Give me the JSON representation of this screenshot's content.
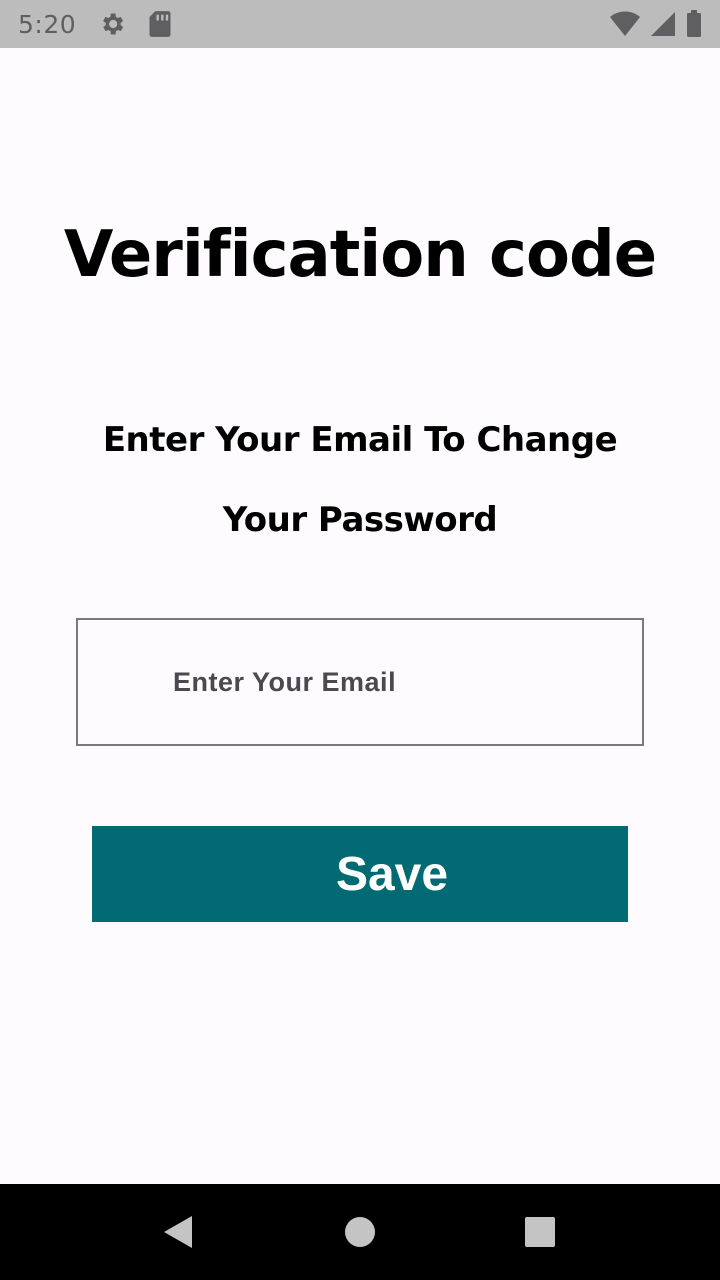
{
  "status_bar": {
    "time": "5:20",
    "icons_left": [
      "settings-icon",
      "sd-card-icon"
    ],
    "icons_right": [
      "wifi-icon",
      "signal-icon",
      "battery-icon"
    ]
  },
  "page": {
    "title": "Verification code",
    "subtitle": "Enter Your Email To Change Your Password"
  },
  "form": {
    "email_value": "",
    "email_placeholder": "Enter Your Email",
    "save_label": "Save"
  },
  "nav_bar": {
    "buttons": [
      "back-icon",
      "home-icon",
      "recents-icon"
    ]
  },
  "colors": {
    "accent": "#016a72",
    "background": "#fdfbfe",
    "status_bar": "#bdbcbd",
    "nav_bar": "#000000"
  }
}
